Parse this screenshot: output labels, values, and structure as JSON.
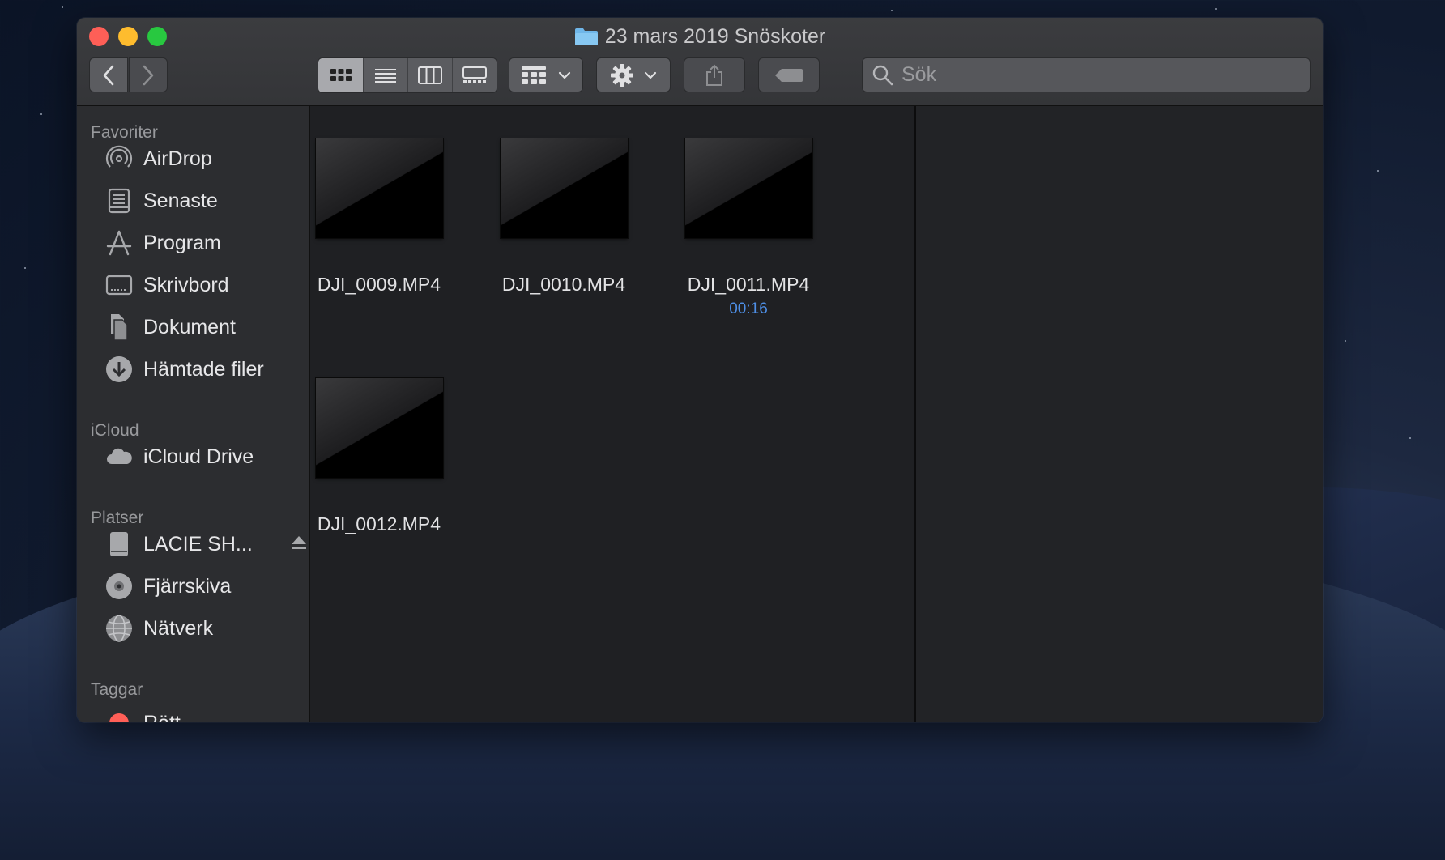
{
  "window": {
    "title": "23 mars 2019 Snöskoter",
    "search": {
      "placeholder": "Sök"
    }
  },
  "sidebar": {
    "sections": {
      "favorites": "Favoriter",
      "icloud": "iCloud",
      "locations": "Platser",
      "tags": "Taggar"
    },
    "favorites": [
      {
        "label": "AirDrop",
        "icon": "airdrop-icon"
      },
      {
        "label": "Senaste",
        "icon": "recents-icon"
      },
      {
        "label": "Program",
        "icon": "applications-icon"
      },
      {
        "label": "Skrivbord",
        "icon": "desktop-icon"
      },
      {
        "label": "Dokument",
        "icon": "documents-icon"
      },
      {
        "label": "Hämtade filer",
        "icon": "downloads-icon"
      }
    ],
    "icloud": [
      {
        "label": "iCloud Drive",
        "icon": "cloud-icon"
      }
    ],
    "locations": [
      {
        "label": "LACIE SH...",
        "icon": "drive-icon"
      },
      {
        "label": "Fjärrskiva",
        "icon": "disc-icon"
      },
      {
        "label": "Nätverk",
        "icon": "network-icon"
      }
    ],
    "tags": [
      {
        "label": "Rött",
        "color": "#ff5f57"
      }
    ]
  },
  "files": [
    {
      "name": "DJI_0009.MP4",
      "meta": ""
    },
    {
      "name": "DJI_0010.MP4",
      "meta": ""
    },
    {
      "name": "DJI_0011.MP4",
      "meta": "00:16"
    },
    {
      "name": "DJI_0012.MP4",
      "meta": ""
    }
  ],
  "colors": {
    "meta_accent": "#4e8fe6",
    "close": "#fe5f57",
    "minimize": "#febc2e",
    "maximize": "#28c840"
  }
}
